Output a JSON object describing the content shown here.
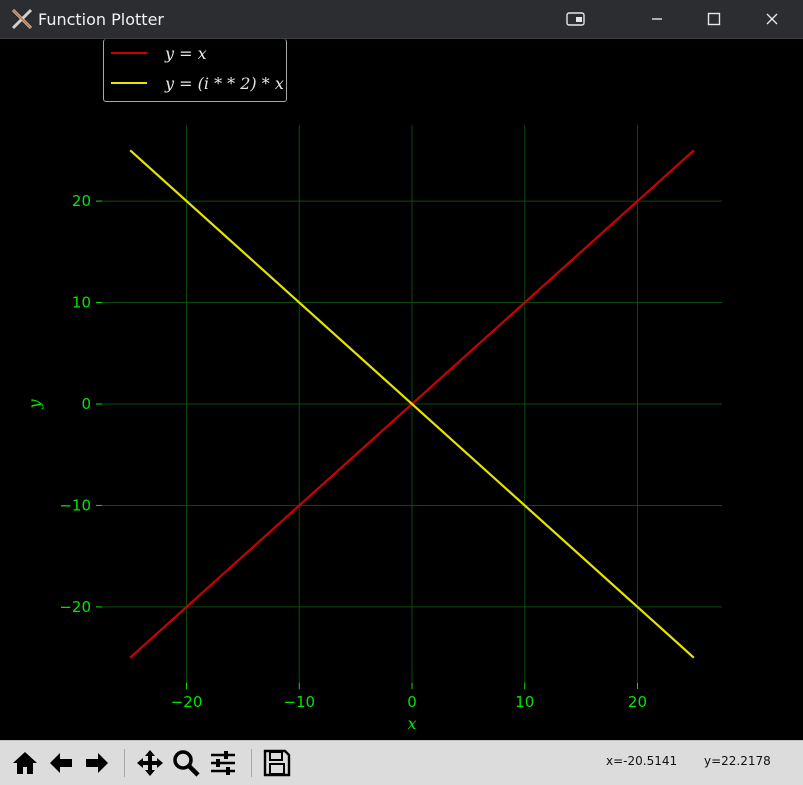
{
  "window": {
    "title": "Function Plotter",
    "controls": [
      "restore",
      "minimize",
      "maximize",
      "close"
    ]
  },
  "legend": {
    "items": [
      {
        "label": "y = x",
        "color": "#cc0000"
      },
      {
        "label": "y = (i * * 2) * x",
        "color": "#e5e500"
      }
    ]
  },
  "toolbar": {
    "tools": [
      "home-icon",
      "back-arrow-icon",
      "forward-arrow-icon",
      "pan-icon",
      "zoom-icon",
      "configure-subplots-icon",
      "save-icon"
    ],
    "coord_x": "x=-20.5141",
    "coord_y": "y=22.2178"
  },
  "chart_data": {
    "type": "line",
    "title": "",
    "xlabel": "x",
    "ylabel": "y",
    "xlim": [
      -27.5,
      27.5
    ],
    "ylim": [
      -27.5,
      27.5
    ],
    "xticks": [
      -20,
      -10,
      0,
      10,
      20
    ],
    "yticks": [
      -20,
      -10,
      0,
      10,
      20
    ],
    "tick_labels_x": [
      "−20",
      "−10",
      "0",
      "10",
      "20"
    ],
    "tick_labels_y": [
      "−20",
      "−10",
      "0",
      "10",
      "20"
    ],
    "grid": true,
    "grid_color": "#0c4a0c",
    "axis_text_color": "#00e600",
    "legend_position": "upper-left",
    "series": [
      {
        "name": "y = x",
        "color": "#cc0000",
        "x": [
          -25,
          25
        ],
        "y": [
          -25,
          25
        ]
      },
      {
        "name": "y = (i * * 2) * x",
        "color": "#e5e500",
        "x": [
          -25,
          25
        ],
        "y": [
          25,
          -25
        ]
      }
    ]
  }
}
